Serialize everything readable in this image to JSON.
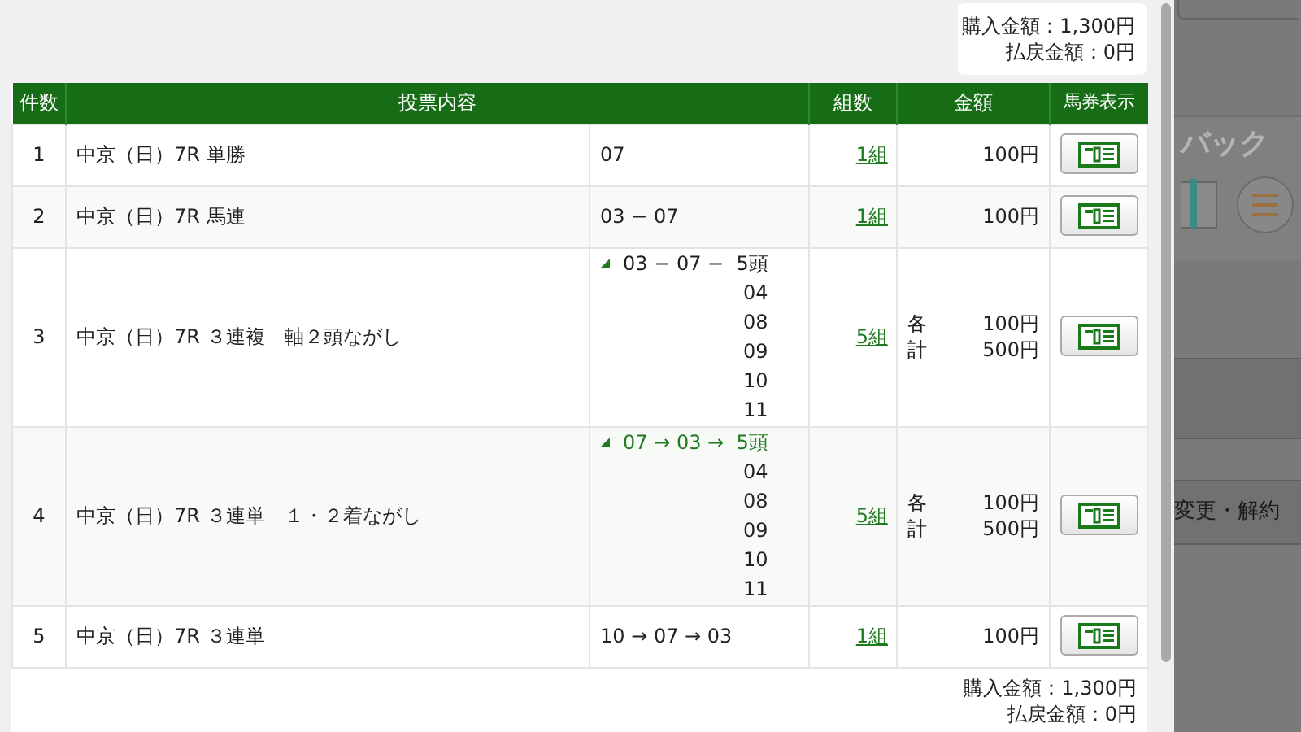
{
  "summary_top": {
    "purchase": "購入金額：1,300円",
    "payout": "払戻金額：0円"
  },
  "table": {
    "columns": [
      "件数",
      "投票内容",
      "組数",
      "金額",
      "馬券表示"
    ],
    "rows": [
      {
        "index": "1",
        "bet": "中京（日）7R 単勝",
        "combination": {
          "kind": "simple",
          "text": "07"
        },
        "count": "1組",
        "amount": [
          {
            "value": "100円"
          }
        ]
      },
      {
        "index": "2",
        "bet": "中京（日）7R 馬連",
        "combination": {
          "kind": "simple",
          "text": "03 − 07"
        },
        "count": "1組",
        "amount": [
          {
            "value": "100円"
          }
        ]
      },
      {
        "index": "3",
        "bet": "中京（日）7R ３連複　軸２頭ながし",
        "combination": {
          "kind": "nagashi",
          "text": "03 − 07 −  5頭",
          "color": "#1f1f1f",
          "items": [
            "04",
            "08",
            "09",
            "10",
            "11"
          ]
        },
        "count": "5組",
        "amount": [
          {
            "label": "各",
            "value": "100円"
          },
          {
            "label": "計",
            "value": "500円"
          }
        ]
      },
      {
        "index": "4",
        "bet": "中京（日）7R ３連単　１・２着ながし",
        "combination": {
          "kind": "nagashi",
          "text": "07 → 03 →  5頭",
          "color": "#207a20",
          "items": [
            "04",
            "08",
            "09",
            "10",
            "11"
          ]
        },
        "count": "5組",
        "amount": [
          {
            "label": "各",
            "value": "100円"
          },
          {
            "label": "計",
            "value": "500円"
          }
        ]
      },
      {
        "index": "5",
        "bet": "中京（日）7R ３連単",
        "combination": {
          "kind": "simple",
          "text": "10 → 07 → 03"
        },
        "count": "1組",
        "amount": [
          {
            "value": "100円"
          }
        ]
      }
    ]
  },
  "summary_bottom": {
    "purchase": "購入金額：1,300円",
    "payout": "払戻金額：0円"
  },
  "background": {
    "banner": "バック",
    "menu_item": "変更・解約"
  }
}
